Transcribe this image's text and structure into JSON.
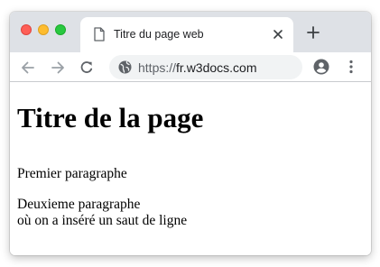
{
  "browser": {
    "tab": {
      "title": "Titre du page web"
    },
    "address_bar": {
      "scheme": "https://",
      "host": "fr.w3docs.com"
    }
  },
  "page": {
    "heading": "Titre de la page",
    "paragraph1": "Premier paragraphe",
    "paragraph2_line1": "Deuxieme paragraphe",
    "paragraph2_line2": "où on a inséré un saut de ligne"
  },
  "icons": {
    "window_controls": [
      "close-dot",
      "minimize-dot",
      "maximize-dot"
    ],
    "tab_favicon": "document-icon",
    "tab_close": "close-icon",
    "new_tab": "plus-icon",
    "back": "arrow-left-icon",
    "forward": "arrow-right-icon",
    "reload": "reload-icon",
    "site_info": "globe-icon",
    "profile": "account-icon",
    "menu": "more-vertical-icon"
  },
  "colors": {
    "titlebar": "#dee1e6",
    "omnibox": "#f1f3f4",
    "close_dot": "#fe5f57",
    "minimize_dot": "#febc2e",
    "maximize_dot": "#28c840"
  }
}
